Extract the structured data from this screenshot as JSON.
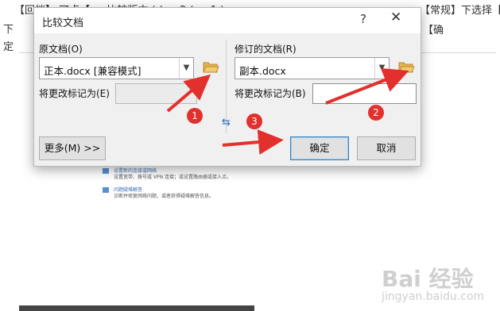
{
  "background": {
    "line1_left": "【回档】   可点【  …    比较版本 ( ( … 2 ( … 1 )     …",
    "line1_right": "【常规】下选择【使用",
    "line2_left": "下",
    "line2_right": "【确",
    "line3_left": "定",
    "network_items": [
      {
        "title": "设置新的连接或网络",
        "desc": "设置宽带、拨号或 VPN 连接；或设置路由器或接入点。"
      },
      {
        "title": "问题疑难解答",
        "desc": "诊断并修复网络问题，或者获得疑难解答信息。"
      }
    ],
    "watermark": "Bai 经验",
    "watermark_sub": "jingyan.baidu.com"
  },
  "dialog": {
    "title": "比较文档",
    "help_glyph": "?",
    "close_glyph": "✕",
    "original": {
      "label": "原文档(O)",
      "value": "正本.docx [兼容模式]",
      "mark_label": "将更改标记为(E)",
      "mark_value": ""
    },
    "revised": {
      "label": "修订的文档(R)",
      "value": "副本.docx",
      "mark_label": "将更改标记为(B)",
      "mark_value": ""
    },
    "swap_glyph": "⇆",
    "more_button": "更多(M) >>",
    "ok_button": "确定",
    "cancel_button": "取消"
  },
  "annotations": {
    "badge1": "1",
    "badge2": "2",
    "badge3": "3",
    "accent_color": "#e2302c"
  }
}
